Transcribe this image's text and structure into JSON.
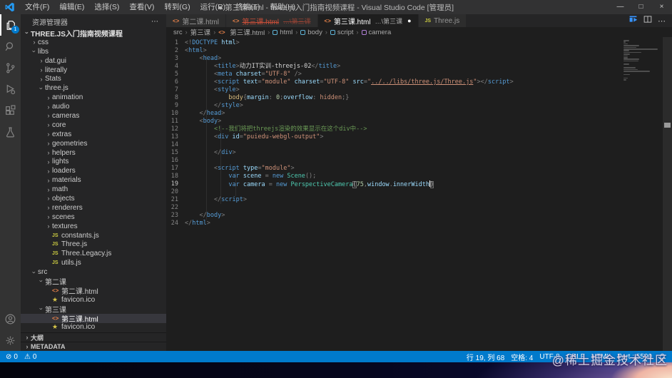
{
  "window": {
    "dot": "●",
    "title": "第三课.html - three.js入门指南视频课程 - Visual Studio Code [管理员]",
    "menus": [
      "文件(F)",
      "编辑(E)",
      "选择(S)",
      "查看(V)",
      "转到(G)",
      "运行(R)",
      "终端(T)",
      "帮助(H)"
    ],
    "controls": {
      "minimize": "—",
      "maximize": "□",
      "close": "×"
    }
  },
  "activity_bar": {
    "badge": "1"
  },
  "sidebar": {
    "header": "资源管理器",
    "header_actions": "⋯",
    "tree": [
      {
        "d": 0,
        "c": "v",
        "t": "THREE.JS入门指南视频课程",
        "b": 1
      },
      {
        "d": 1,
        "c": ">",
        "t": "css"
      },
      {
        "d": 1,
        "c": "v",
        "t": "libs"
      },
      {
        "d": 2,
        "c": ">",
        "t": "dat.gui"
      },
      {
        "d": 2,
        "c": ">",
        "t": "literally"
      },
      {
        "d": 2,
        "c": ">",
        "t": "Stats"
      },
      {
        "d": 2,
        "c": "v",
        "t": "three.js"
      },
      {
        "d": 3,
        "c": ">",
        "t": "animation"
      },
      {
        "d": 3,
        "c": ">",
        "t": "audio"
      },
      {
        "d": 3,
        "c": ">",
        "t": "cameras"
      },
      {
        "d": 3,
        "c": ">",
        "t": "core"
      },
      {
        "d": 3,
        "c": ">",
        "t": "extras"
      },
      {
        "d": 3,
        "c": ">",
        "t": "geometries"
      },
      {
        "d": 3,
        "c": ">",
        "t": "helpers"
      },
      {
        "d": 3,
        "c": ">",
        "t": "lights"
      },
      {
        "d": 3,
        "c": ">",
        "t": "loaders"
      },
      {
        "d": 3,
        "c": ">",
        "t": "materials"
      },
      {
        "d": 3,
        "c": ">",
        "t": "math"
      },
      {
        "d": 3,
        "c": ">",
        "t": "objects"
      },
      {
        "d": 3,
        "c": ">",
        "t": "renderers"
      },
      {
        "d": 3,
        "c": ">",
        "t": "scenes"
      },
      {
        "d": 3,
        "c": ">",
        "t": "textures"
      },
      {
        "d": 3,
        "i": "js",
        "t": "constants.js"
      },
      {
        "d": 3,
        "i": "js",
        "t": "Three.js"
      },
      {
        "d": 3,
        "i": "js",
        "t": "Three.Legacy.js"
      },
      {
        "d": 3,
        "i": "js",
        "t": "utils.js"
      },
      {
        "d": 1,
        "c": "v",
        "t": "src"
      },
      {
        "d": 2,
        "c": "v",
        "t": "第二课"
      },
      {
        "d": 3,
        "i": "html",
        "t": "第二课.html"
      },
      {
        "d": 3,
        "i": "star",
        "t": "favicon.ico"
      },
      {
        "d": 2,
        "c": "v",
        "t": "第三课"
      },
      {
        "d": 3,
        "i": "html",
        "t": "第三课.html",
        "sel": 1
      },
      {
        "d": 3,
        "i": "star",
        "t": "favicon.ico"
      }
    ],
    "sections": [
      "大纲",
      "METADATA"
    ]
  },
  "tabs": [
    {
      "label": "第二课.html",
      "icon": "html",
      "state": "inactive"
    },
    {
      "label": "第三课.html",
      "desc": "…\\第三课",
      "icon": "html",
      "state": "deleted"
    },
    {
      "label": "第三课.html",
      "desc": "…\\第三课",
      "icon": "html",
      "state": "active",
      "dot": "●"
    },
    {
      "label": "Three.js",
      "icon": "js",
      "state": "inactive"
    }
  ],
  "tab_actions": {
    "more": "⋯"
  },
  "breadcrumbs": [
    {
      "label": "src"
    },
    {
      "label": "第三课"
    },
    {
      "label": "第三课.html",
      "icon": "html"
    },
    {
      "label": "html",
      "icon": "sym"
    },
    {
      "label": "body",
      "icon": "sym"
    },
    {
      "label": "script",
      "icon": "sym"
    },
    {
      "label": "camera",
      "icon": "var"
    }
  ],
  "editor": {
    "lines": [
      {
        "n": 1,
        "t": [
          [
            "pn",
            "<!"
          ],
          [
            "kw",
            "DOCTYPE"
          ],
          [
            "at",
            " html"
          ],
          [
            "pn",
            ">"
          ]
        ]
      },
      {
        "n": 2,
        "t": [
          [
            "pn",
            "<"
          ],
          [
            "tag",
            "html"
          ],
          [
            "pn",
            ">"
          ]
        ]
      },
      {
        "n": 3,
        "t": [
          [
            "pn",
            "    <"
          ],
          [
            "tag",
            "head"
          ],
          [
            "pn",
            ">"
          ]
        ]
      },
      {
        "n": 4,
        "t": [
          [
            "pn",
            "        <"
          ],
          [
            "tag",
            "title"
          ],
          [
            "pn",
            ">"
          ],
          [
            "tx",
            "动力IT实训-threejs-02"
          ],
          [
            "pn",
            "</"
          ],
          [
            "tag",
            "title"
          ],
          [
            "pn",
            ">"
          ]
        ]
      },
      {
        "n": 5,
        "t": [
          [
            "pn",
            "        <"
          ],
          [
            "tag",
            "meta"
          ],
          [
            "at",
            " charset"
          ],
          [
            "pn",
            "="
          ],
          [
            "st",
            "\"UTF-8\""
          ],
          [
            "pn",
            " />"
          ]
        ]
      },
      {
        "n": 6,
        "t": [
          [
            "pn",
            "        <"
          ],
          [
            "tag",
            "script"
          ],
          [
            "at",
            " text"
          ],
          [
            "pn",
            "="
          ],
          [
            "st",
            "\"module\""
          ],
          [
            "at",
            " charset"
          ],
          [
            "pn",
            "="
          ],
          [
            "st",
            "\"UTF-8\""
          ],
          [
            "at",
            " src"
          ],
          [
            "pn",
            "="
          ],
          [
            "st",
            "\""
          ],
          [
            "lnk",
            "../../libs/three.js/Three.js"
          ],
          [
            "st",
            "\""
          ],
          [
            "pn",
            "></"
          ],
          [
            "tag",
            "script"
          ],
          [
            "pn",
            ">"
          ]
        ]
      },
      {
        "n": 7,
        "t": [
          [
            "pn",
            "        <"
          ],
          [
            "tag",
            "style"
          ],
          [
            "pn",
            ">"
          ]
        ]
      },
      {
        "n": 8,
        "t": [
          [
            "sel",
            "            body"
          ],
          [
            "pn",
            "{"
          ],
          [
            "at",
            "margin"
          ],
          [
            "pn",
            ": "
          ],
          [
            "num",
            "0"
          ],
          [
            "pn",
            ";"
          ],
          [
            "at",
            "overflow"
          ],
          [
            "pn",
            ": "
          ],
          [
            "val",
            "hidden"
          ],
          [
            "pn",
            ";}"
          ]
        ]
      },
      {
        "n": 9,
        "t": [
          [
            "pn",
            "        </"
          ],
          [
            "tag",
            "style"
          ],
          [
            "pn",
            ">"
          ]
        ]
      },
      {
        "n": 10,
        "t": [
          [
            "pn",
            "    </"
          ],
          [
            "tag",
            "head"
          ],
          [
            "pn",
            ">"
          ]
        ]
      },
      {
        "n": 11,
        "t": [
          [
            "pn",
            "    <"
          ],
          [
            "tag",
            "body"
          ],
          [
            "pn",
            ">"
          ]
        ]
      },
      {
        "n": 12,
        "t": [
          [
            "cm",
            "        <!--我们将把threejs渲染的效果显示在这个div中-->"
          ]
        ]
      },
      {
        "n": 13,
        "t": [
          [
            "pn",
            "        <"
          ],
          [
            "tag",
            "div"
          ],
          [
            "at",
            " id"
          ],
          [
            "pn",
            "="
          ],
          [
            "st",
            "\"puiedu-webgl-output\""
          ],
          [
            "pn",
            ">"
          ]
        ]
      },
      {
        "n": 14,
        "t": []
      },
      {
        "n": 15,
        "t": [
          [
            "pn",
            "        </"
          ],
          [
            "tag",
            "div"
          ],
          [
            "pn",
            ">"
          ]
        ]
      },
      {
        "n": 16,
        "t": []
      },
      {
        "n": 17,
        "t": [
          [
            "pn",
            "        <"
          ],
          [
            "tag",
            "script"
          ],
          [
            "at",
            " type"
          ],
          [
            "pn",
            "="
          ],
          [
            "st",
            "\"module\""
          ],
          [
            "pn",
            ">"
          ]
        ]
      },
      {
        "n": 18,
        "t": [
          [
            "pn",
            "            "
          ],
          [
            "kw",
            "var"
          ],
          [
            "vr",
            " scene "
          ],
          [
            "pn",
            "= "
          ],
          [
            "kw",
            "new"
          ],
          [
            "cl",
            " Scene"
          ],
          [
            "pn",
            "();"
          ]
        ]
      },
      {
        "n": 19,
        "cur": 1,
        "t": [
          [
            "pn",
            "            "
          ],
          [
            "kw",
            "var"
          ],
          [
            "vr",
            " camera "
          ],
          [
            "pn",
            "= "
          ],
          [
            "kw",
            "new"
          ],
          [
            "cl",
            " PerspectiveCamera"
          ],
          [
            "brk",
            "("
          ],
          [
            "num",
            "75"
          ],
          [
            "pn",
            ","
          ],
          [
            "vr",
            "window"
          ],
          [
            "pn",
            "."
          ],
          [
            "vr",
            "innerWidth"
          ],
          [
            "caret",
            ""
          ],
          [
            "brk",
            ")"
          ]
        ]
      },
      {
        "n": 20,
        "t": []
      },
      {
        "n": 21,
        "t": [
          [
            "pn",
            "        </"
          ],
          [
            "tag",
            "script"
          ],
          [
            "pn",
            ">"
          ]
        ]
      },
      {
        "n": 22,
        "t": []
      },
      {
        "n": 23,
        "t": [
          [
            "pn",
            "    </"
          ],
          [
            "tag",
            "body"
          ],
          [
            "pn",
            ">"
          ]
        ]
      },
      {
        "n": 24,
        "t": [
          [
            "pn",
            "</"
          ],
          [
            "tag",
            "html"
          ],
          [
            "pn",
            ">"
          ]
        ]
      }
    ]
  },
  "status_bar": {
    "errors": "0",
    "warnings": "0",
    "right": [
      "行 19, 列 68",
      "空格: 4",
      "UTF-8",
      "CRLF",
      "HTML",
      "Port : 5500"
    ]
  },
  "watermark": "@稀土掘金技术社区",
  "colors": {
    "accent": "#007acc",
    "editor_bg": "#1e1e1e",
    "deleted_tab": "#c74e39",
    "html_icon": "#e8824a",
    "js_icon": "#cbcb41"
  }
}
